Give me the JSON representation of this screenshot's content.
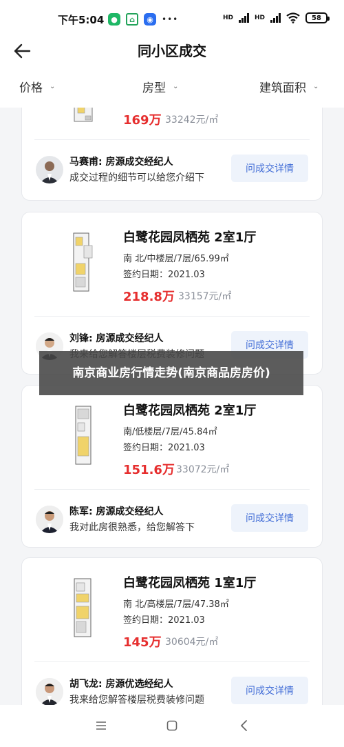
{
  "status_bar": {
    "time": "下午5:04",
    "signal_1_label": "HD",
    "signal_2_label": "HD",
    "battery": "58"
  },
  "header": {
    "title": "同小区成交",
    "back_icon": "arrow-left-icon"
  },
  "filters": [
    {
      "label": "价格"
    },
    {
      "label": "房型"
    },
    {
      "label": "建筑面积"
    }
  ],
  "listings": [
    {
      "title": "",
      "info": "",
      "date": "",
      "price": "169万",
      "unit_price": "33242元/㎡",
      "agent_name": "马赛甫: 房源成交经纪人",
      "agent_msg": "成交过程的细节可以给您介绍下",
      "button": "问成交详情"
    },
    {
      "title": "白鹭花园凤栖苑 2室1厅",
      "info": "南 北/中楼层/7层/65.99㎡",
      "date": "签约日期：2021.03",
      "price": "218.8万",
      "unit_price": "33157元/㎡",
      "agent_name": "刘锋: 房源成交经纪人",
      "agent_msg": "我来给您解答楼层税费装修问题",
      "button": "问成交详情"
    },
    {
      "title": "白鹭花园凤栖苑 2室1厅",
      "info": "南/低楼层/7层/45.84㎡",
      "date": "签约日期：2021.03",
      "price": "151.6万",
      "unit_price": "33072元/㎡",
      "agent_name": "陈军: 房源成交经纪人",
      "agent_msg": "我对此房很熟悉，给您解答下",
      "button": "问成交详情"
    },
    {
      "title": "白鹭花园凤栖苑 1室1厅",
      "info": "南 北/高楼层/7层/47.38㎡",
      "date": "签约日期：2021.03",
      "price": "145万",
      "unit_price": "30604元/㎡",
      "agent_name": "胡飞龙: 房源优选经纪人",
      "agent_msg": "我来给您解答楼层税费装修问题",
      "button": "问成交详情"
    }
  ],
  "overlay": {
    "text": "南京商业房行情走势(南京商品房房价)"
  },
  "system_nav": [
    "menu-icon",
    "home-square-icon",
    "back-chevron-icon"
  ],
  "colors": {
    "price_red": "#e62e2e",
    "button_blue": "#3f6bd6",
    "button_bg": "#eef3fb"
  }
}
